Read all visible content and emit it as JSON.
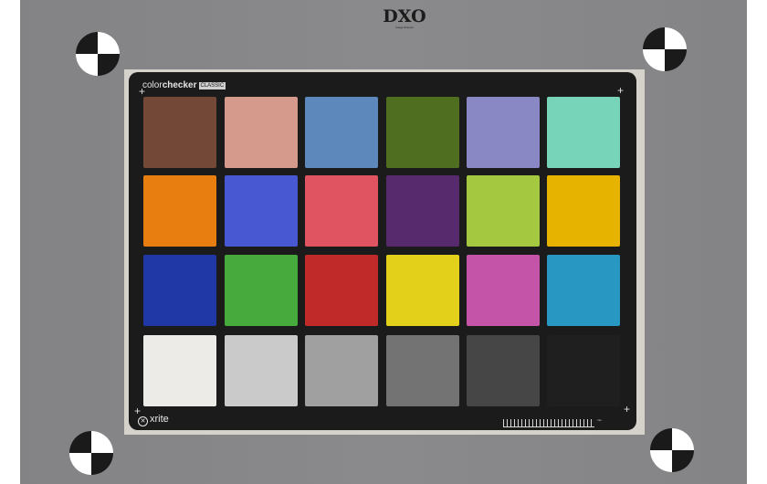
{
  "board": {
    "logo_text": "DXO",
    "logo_subtitle": "Image Science"
  },
  "chart_card": {
    "brand_prefix": "color",
    "brand_bold": "checker",
    "brand_badge": "CLASSIC",
    "maker": "xrite",
    "maker_glyph": "✕",
    "ruler_unit": "mm"
  },
  "swatches": [
    {
      "color": "#744836"
    },
    {
      "color": "#d59a8c"
    },
    {
      "color": "#5c88bc"
    },
    {
      "color": "#4f6e20"
    },
    {
      "color": "#8a88c4"
    },
    {
      "color": "#78d4b8"
    },
    {
      "color": "#e87e10"
    },
    {
      "color": "#4758d2"
    },
    {
      "color": "#e05462"
    },
    {
      "color": "#562a6c"
    },
    {
      "color": "#a4c840"
    },
    {
      "color": "#e6b400"
    },
    {
      "color": "#2038a6"
    },
    {
      "color": "#46aa3c"
    },
    {
      "color": "#c02a28"
    },
    {
      "color": "#e2d01a"
    },
    {
      "color": "#c454a8"
    },
    {
      "color": "#2898c2"
    },
    {
      "color": "#ecebe8"
    },
    {
      "color": "#cacaca"
    },
    {
      "color": "#a0a0a0"
    },
    {
      "color": "#737373"
    },
    {
      "color": "#454645"
    },
    {
      "color": "#1f1f1f"
    }
  ],
  "registration_marks": [
    "crosshair",
    "crosshair",
    "crosshair",
    "crosshair"
  ]
}
